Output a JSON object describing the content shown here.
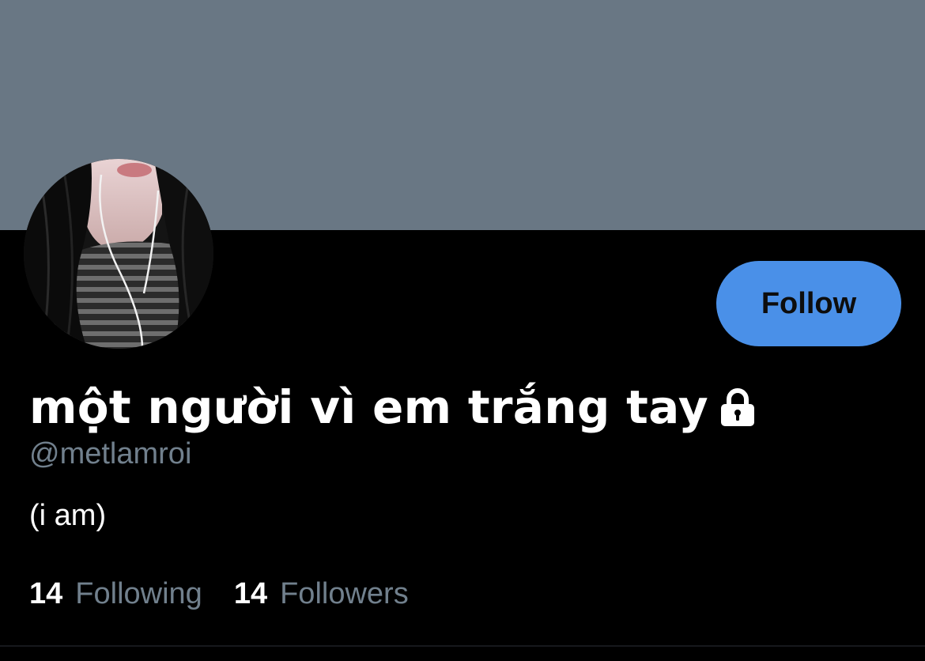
{
  "banner": {
    "color": "#697784"
  },
  "profile": {
    "avatar_alt": "profile photo",
    "follow_label": "Follow",
    "display_name": "một người vì em trắng tay",
    "lock_icon": "lock-icon",
    "handle": "@metlamroi",
    "bio": "(i am)",
    "stats": {
      "following_count": "14",
      "following_label": "Following",
      "followers_count": "14",
      "followers_label": "Followers"
    }
  },
  "colors": {
    "accent": "#4a90e8",
    "secondary_text": "#71808d",
    "background": "#000000"
  }
}
